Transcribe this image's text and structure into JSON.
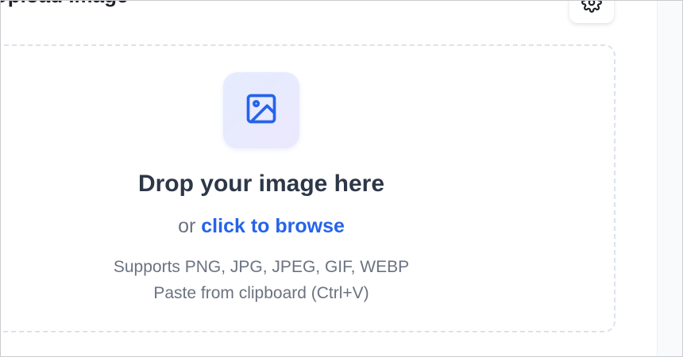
{
  "header": {
    "title": "Upload Image",
    "settings_icon": "gear-icon"
  },
  "dropzone": {
    "icon": "image-icon",
    "title": "Drop your image here",
    "or_text": "or",
    "browse_link": "click to browse",
    "formats_hint": "Supports PNG, JPG, JPEG, GIF, WEBP",
    "paste_hint": "Paste from clipboard (Ctrl+V)"
  },
  "colors": {
    "accent": "#2563eb",
    "title_text": "#2d3748",
    "muted_text": "#6b7280",
    "dashed_border": "#dbe3ec"
  }
}
